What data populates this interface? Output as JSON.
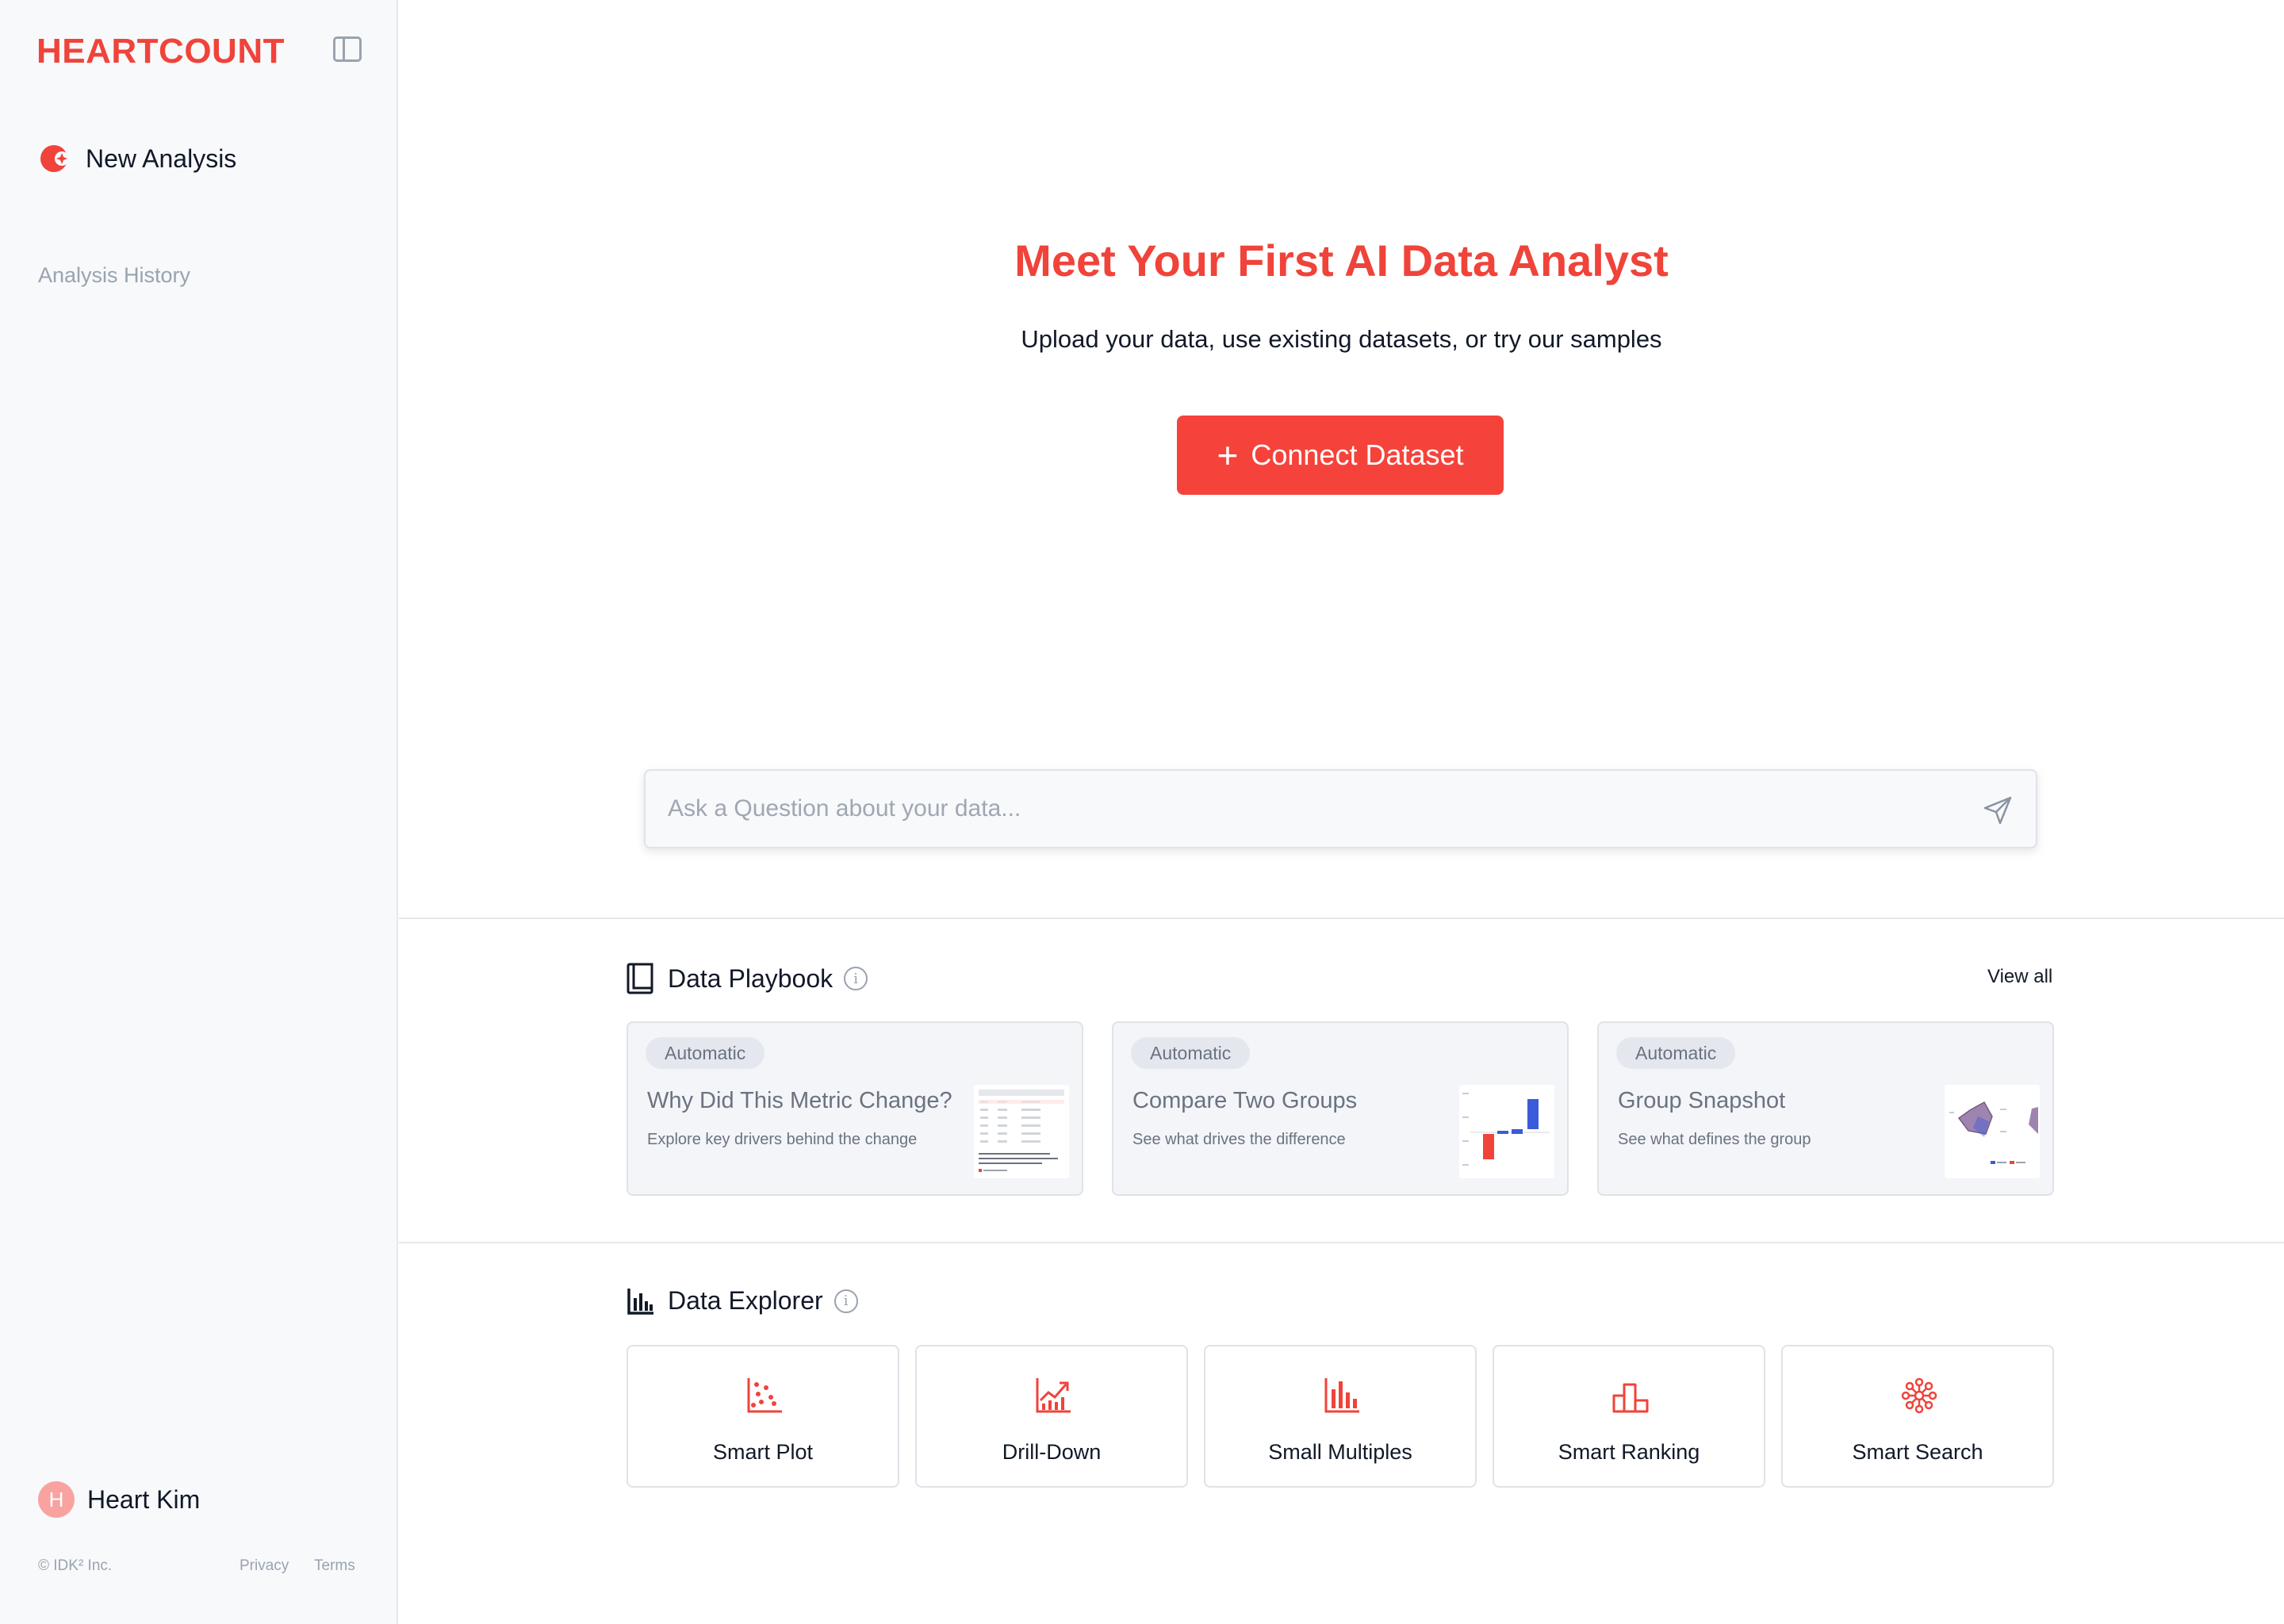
{
  "app": {
    "logo": "HEARTCOUNT",
    "brand_color": "#f0433a"
  },
  "sidebar": {
    "new_analysis_label": "New Analysis",
    "history_label": "Analysis History",
    "user": {
      "initial": "H",
      "name": "Heart Kim"
    },
    "footer": {
      "copyright": "© IDK² Inc.",
      "privacy": "Privacy",
      "terms": "Terms"
    }
  },
  "hero": {
    "title": "Meet Your First AI Data Analyst",
    "subtitle": "Upload your data, use existing datasets, or try our samples",
    "connect_label": "Connect Dataset"
  },
  "ask": {
    "placeholder": "Ask a Question about your data..."
  },
  "playbook": {
    "title": "Data Playbook",
    "info_glyph": "i",
    "view_all": "View all",
    "cards": [
      {
        "badge": "Automatic",
        "title": "Why Did This Metric Change?",
        "desc": "Explore key drivers behind the change",
        "thumb": "table-thumbnail"
      },
      {
        "badge": "Automatic",
        "title": "Compare Two Groups",
        "desc": "See what drives the difference",
        "thumb": "bar-thumbnail"
      },
      {
        "badge": "Automatic",
        "title": "Group Snapshot",
        "desc": "See what defines the group",
        "thumb": "radar-thumbnail"
      }
    ]
  },
  "explorer": {
    "title": "Data Explorer",
    "info_glyph": "i",
    "cards": [
      {
        "label": "Smart Plot",
        "icon": "scatter-plot-icon"
      },
      {
        "label": "Drill-Down",
        "icon": "trend-chart-icon"
      },
      {
        "label": "Small Multiples",
        "icon": "bar-chart-icon"
      },
      {
        "label": "Smart Ranking",
        "icon": "podium-icon"
      },
      {
        "label": "Smart Search",
        "icon": "network-icon"
      }
    ]
  }
}
